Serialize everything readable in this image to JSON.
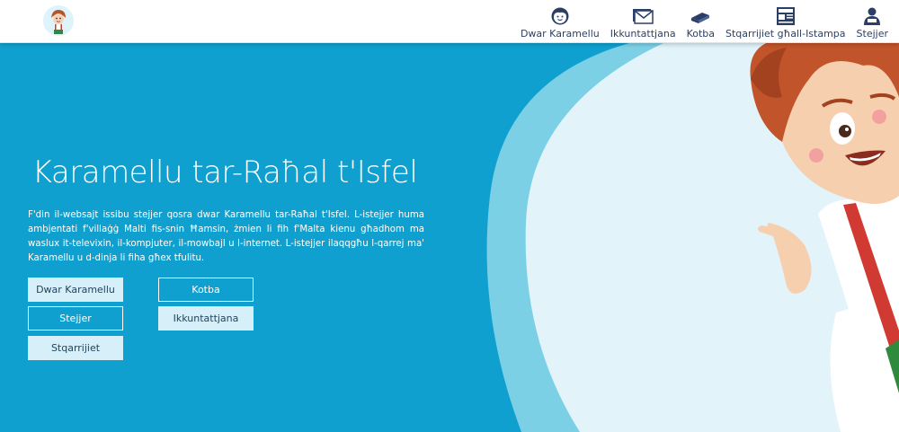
{
  "header": {
    "nav": [
      {
        "label": "Dwar Karamellu",
        "icon": "face-icon"
      },
      {
        "label": "Ikkuntattjana",
        "icon": "mail-icon"
      },
      {
        "label": "Kotba",
        "icon": "book-icon"
      },
      {
        "label": "Stqarrijiet għall-Istampa",
        "icon": "newspaper-icon"
      },
      {
        "label": "Stejjer",
        "icon": "storyteller-icon"
      }
    ]
  },
  "hero": {
    "title": "Karamellu tar-Raħal t'Isfel",
    "description": "F'din il-websajt issibu stejjer qosra dwar Karamellu tar-Raħal t'Isfel. L-istejjer huma ambjentati f'villaġġ Malti fis-snin Ħamsin, żmien li fih f'Malta kienu għadhom ma waslux it-televixin, il-kompjuter, il-mowbajl u l-internet. L-istejjer ilaqqgħu l-qarrej ma' Karamellu u d-dinja li fiha għex tfulitu.",
    "buttons": {
      "dwar": "Dwar Karamellu",
      "kotba": "Kotba",
      "stejjer": "Stejjer",
      "ikkuntattjana": "Ikkuntattjana",
      "stqarrijiet": "Stqarrijiet"
    }
  },
  "colors": {
    "hero_bg": "#0fa0cf",
    "blob_light": "#e2f3fa",
    "blob_mid": "#7cd0e6",
    "nav_text": "#2b3f66"
  }
}
